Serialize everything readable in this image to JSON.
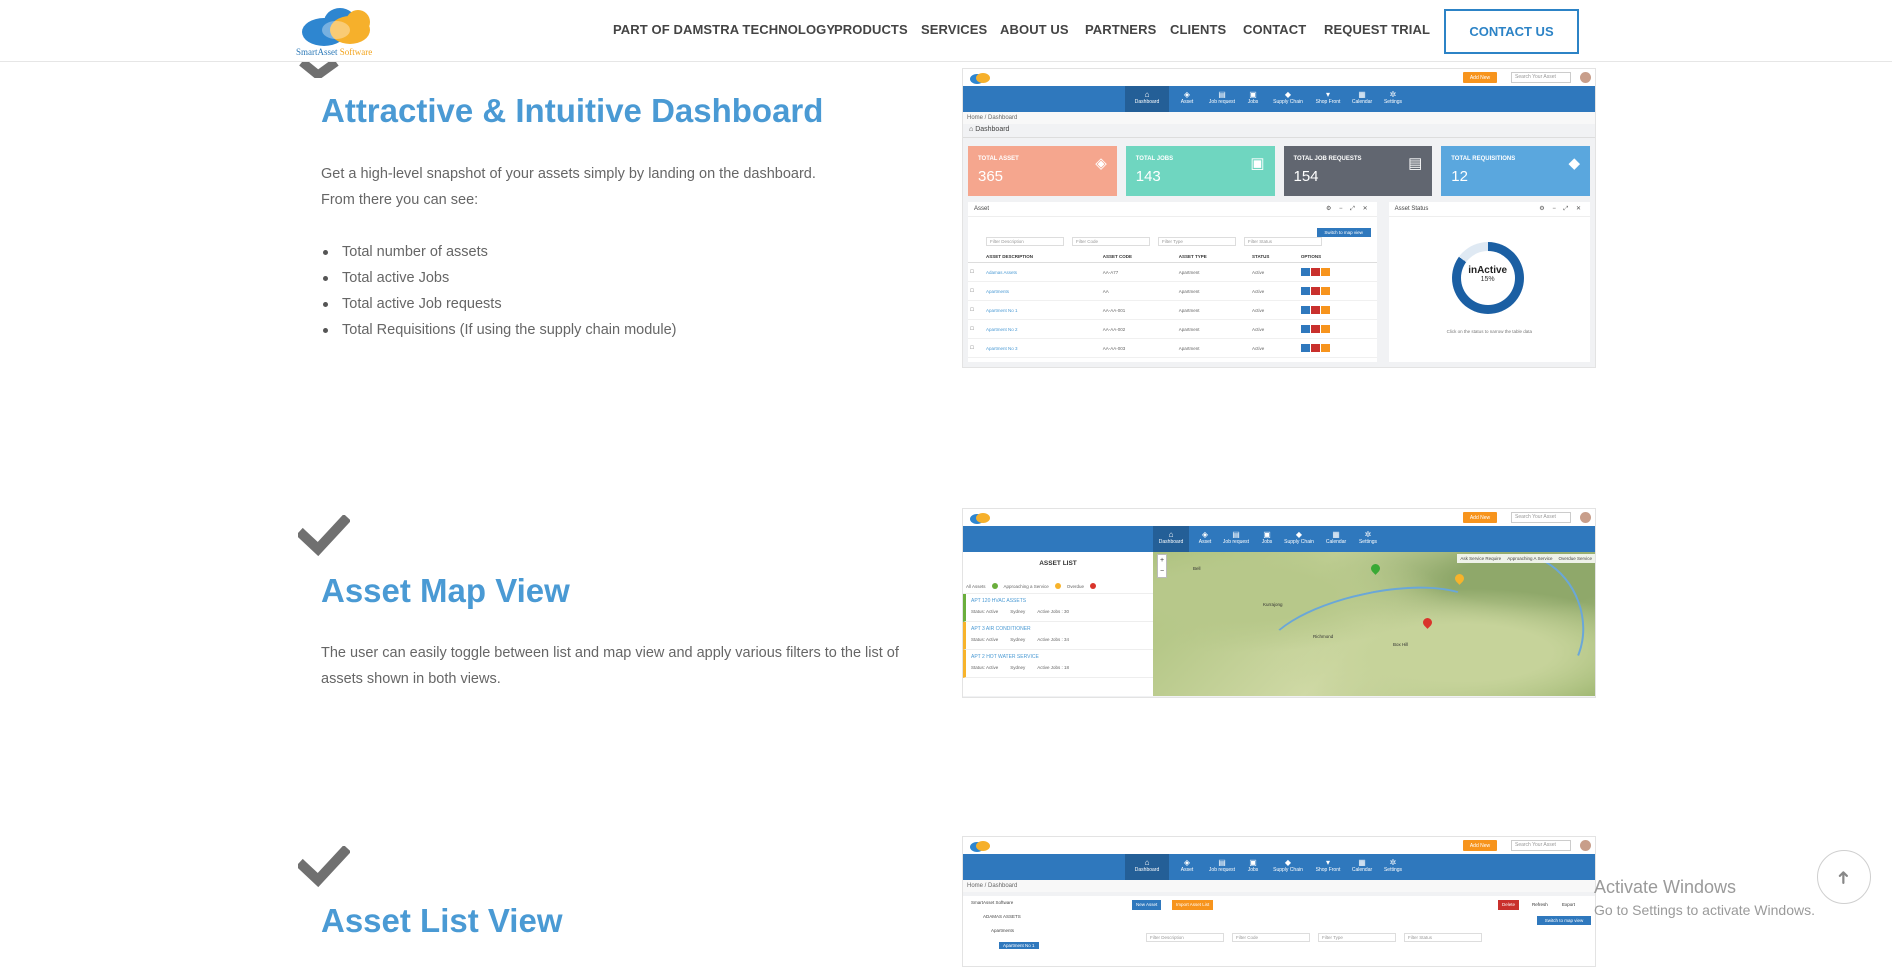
{
  "header": {
    "logo_text_a": "SmartAsset",
    "logo_text_b": "Software",
    "nav": [
      "PART OF DAMSTRA TECHNOLOGY",
      "PRODUCTS",
      "SERVICES",
      "ABOUT US",
      "PARTNERS",
      "CLIENTS",
      "CONTACT",
      "REQUEST TRIAL"
    ],
    "contact_button": "CONTACT US"
  },
  "sections": [
    {
      "title": "Attractive & Intuitive Dashboard",
      "paragraph_line1": "Get a high-level snapshot of your assets simply by landing on the dashboard.",
      "paragraph_line2": "From there you can see:",
      "bullets": [
        "Total number of assets",
        "Total active Jobs",
        "Total active Job requests",
        "Total Requisitions (If using the supply chain module)"
      ]
    },
    {
      "title": "Asset Map View",
      "paragraph": "The user can easily toggle between list and map view and apply various filters to the list of assets shown in both views."
    },
    {
      "title": "Asset List View"
    }
  ],
  "app": {
    "add_new": "Add New",
    "search_placeholder": "Search Your Asset",
    "tabs": [
      "Dashboard",
      "Asset",
      "Job request",
      "Jobs",
      "Supply Chain",
      "Shop Front",
      "Calendar",
      "Settings"
    ],
    "breadcrumb": "Home / Dashboard",
    "dashboard_title": "Dashboard",
    "tiles": [
      {
        "label": "TOTAL ASSET",
        "value": "365",
        "color": "#f5a68e"
      },
      {
        "label": "TOTAL JOBS",
        "value": "143",
        "color": "#6fd6c0"
      },
      {
        "label": "TOTAL JOB REQUESTS",
        "value": "154",
        "color": "#616670"
      },
      {
        "label": "TOTAL REQUISITIONS",
        "value": "12",
        "color": "#5aa7de"
      }
    ],
    "asset_panel_title": "Asset",
    "asset_status_title": "Asset Status",
    "map_view_button": "Switch to map view",
    "filters": [
      "Filter Description",
      "Filter Code",
      "Filter Type",
      "Filter Status"
    ],
    "table_headers": [
      "ASSET DESCRIPTION",
      "ASSET CODE",
      "ASSET TYPE",
      "STATUS",
      "OPTIONS"
    ],
    "table_rows": [
      {
        "desc": "Adamas Assets",
        "code": "AA-A77",
        "type": "Apartment",
        "status": "Active"
      },
      {
        "desc": "Apartments",
        "code": "AA",
        "type": "Apartment",
        "status": "Active"
      },
      {
        "desc": "Apartment No 1",
        "code": "AA-AA-001",
        "type": "Apartment",
        "status": "Active"
      },
      {
        "desc": "Apartment No 2",
        "code": "AA-AA-002",
        "type": "Apartment",
        "status": "Active"
      },
      {
        "desc": "Apartment No 3",
        "code": "AA-AA-003",
        "type": "Apartment",
        "status": "Active"
      }
    ],
    "donut_label": "inActive",
    "donut_value": "15%",
    "donut_caption": "Click on the status to narrow the table data",
    "asset_list_title": "ASSET LIST",
    "map_legend": [
      "Ask Service Require",
      "Approaching A Service",
      "Overdue Service"
    ],
    "list_legend": [
      "All Assets",
      "Approaching a Service",
      "Overdue"
    ],
    "list_items": [
      {
        "name": "APT 120 HVAC ASSETS",
        "status": "Status: Active",
        "city": "Sydney",
        "jobs": "Active Jobs : 30"
      },
      {
        "name": "APT 3 AIR CONDITIONER",
        "status": "Status: Active",
        "city": "Sydney",
        "jobs": "Active Jobs : 34"
      },
      {
        "name": "APT 2 HOT WATER SERVICE",
        "status": "Status: Active",
        "city": "Sydney",
        "jobs": "Active Jobs : 18"
      }
    ],
    "map_places": [
      "Richmond",
      "Kurrajong",
      "Bell",
      "Box Hill"
    ],
    "tree": [
      "SmartAsset Software",
      "ADAMAS ASSETS",
      "Apartments",
      "Apartment No 1"
    ],
    "list_buttons": {
      "new": "New Asset",
      "import": "Import Asset List",
      "delete": "Delete",
      "refresh": "Refresh",
      "export": "Export"
    }
  },
  "windows": {
    "line1": "Activate Windows",
    "line2": "Go to Settings to activate Windows."
  }
}
